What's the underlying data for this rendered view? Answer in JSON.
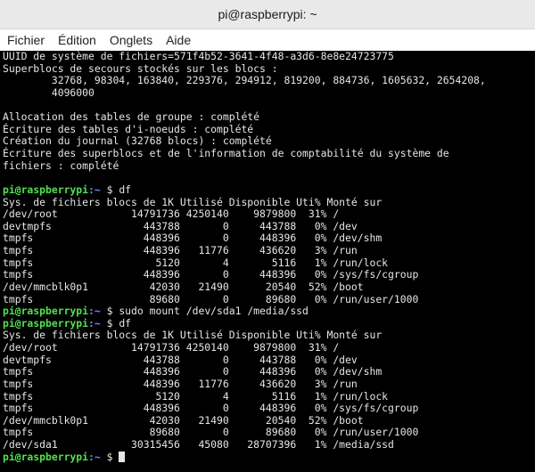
{
  "window": {
    "title": "pi@raspberrypi: ~"
  },
  "menu": [
    {
      "label": "Fichier"
    },
    {
      "label": "Édition"
    },
    {
      "label": "Onglets"
    },
    {
      "label": "Aide"
    }
  ],
  "terminal": {
    "prompt": {
      "user": "pi@raspberrypi",
      "path": ":~",
      "sym": " $ "
    },
    "lines": [
      {
        "t": "UUID de système de fichiers=571f4b52-3641-4f48-a3d6-8e8e24723775"
      },
      {
        "t": "Superblocs de secours stockés sur les blocs :"
      },
      {
        "t": "        32768, 98304, 163840, 229376, 294912, 819200, 884736, 1605632, 2654208,"
      },
      {
        "t": "        4096000"
      },
      {
        "t": ""
      },
      {
        "t": "Allocation des tables de groupe : complété"
      },
      {
        "t": "Écriture des tables d'i-noeuds : complété"
      },
      {
        "t": "Création du journal (32768 blocs) : complété"
      },
      {
        "t": "Écriture des superblocs et de l'information de comptabilité du système de"
      },
      {
        "t": "fichiers : complété"
      },
      {
        "t": ""
      },
      {
        "cmd": "df"
      },
      {
        "t": "Sys. de fichiers blocs de 1K Utilisé Disponible Uti% Monté sur"
      },
      {
        "t": "/dev/root            14791736 4250140    9879800  31% /"
      },
      {
        "t": "devtmpfs               443788       0     443788   0% /dev"
      },
      {
        "t": "tmpfs                  448396       0     448396   0% /dev/shm"
      },
      {
        "t": "tmpfs                  448396   11776     436620   3% /run"
      },
      {
        "t": "tmpfs                    5120       4       5116   1% /run/lock"
      },
      {
        "t": "tmpfs                  448396       0     448396   0% /sys/fs/cgroup"
      },
      {
        "t": "/dev/mmcblk0p1          42030   21490      20540  52% /boot"
      },
      {
        "t": "tmpfs                   89680       0      89680   0% /run/user/1000"
      },
      {
        "cmd": "sudo mount /dev/sda1 /media/ssd"
      },
      {
        "cmd": "df"
      },
      {
        "t": "Sys. de fichiers blocs de 1K Utilisé Disponible Uti% Monté sur"
      },
      {
        "t": "/dev/root            14791736 4250140    9879800  31% /"
      },
      {
        "t": "devtmpfs               443788       0     443788   0% /dev"
      },
      {
        "t": "tmpfs                  448396       0     448396   0% /dev/shm"
      },
      {
        "t": "tmpfs                  448396   11776     436620   3% /run"
      },
      {
        "t": "tmpfs                    5120       4       5116   1% /run/lock"
      },
      {
        "t": "tmpfs                  448396       0     448396   0% /sys/fs/cgroup"
      },
      {
        "t": "/dev/mmcblk0p1          42030   21490      20540  52% /boot"
      },
      {
        "t": "tmpfs                   89680       0      89680   0% /run/user/1000"
      },
      {
        "t": "/dev/sda1            30315456   45080   28707396   1% /media/ssd"
      },
      {
        "cmd": "",
        "cursor": true
      }
    ]
  }
}
